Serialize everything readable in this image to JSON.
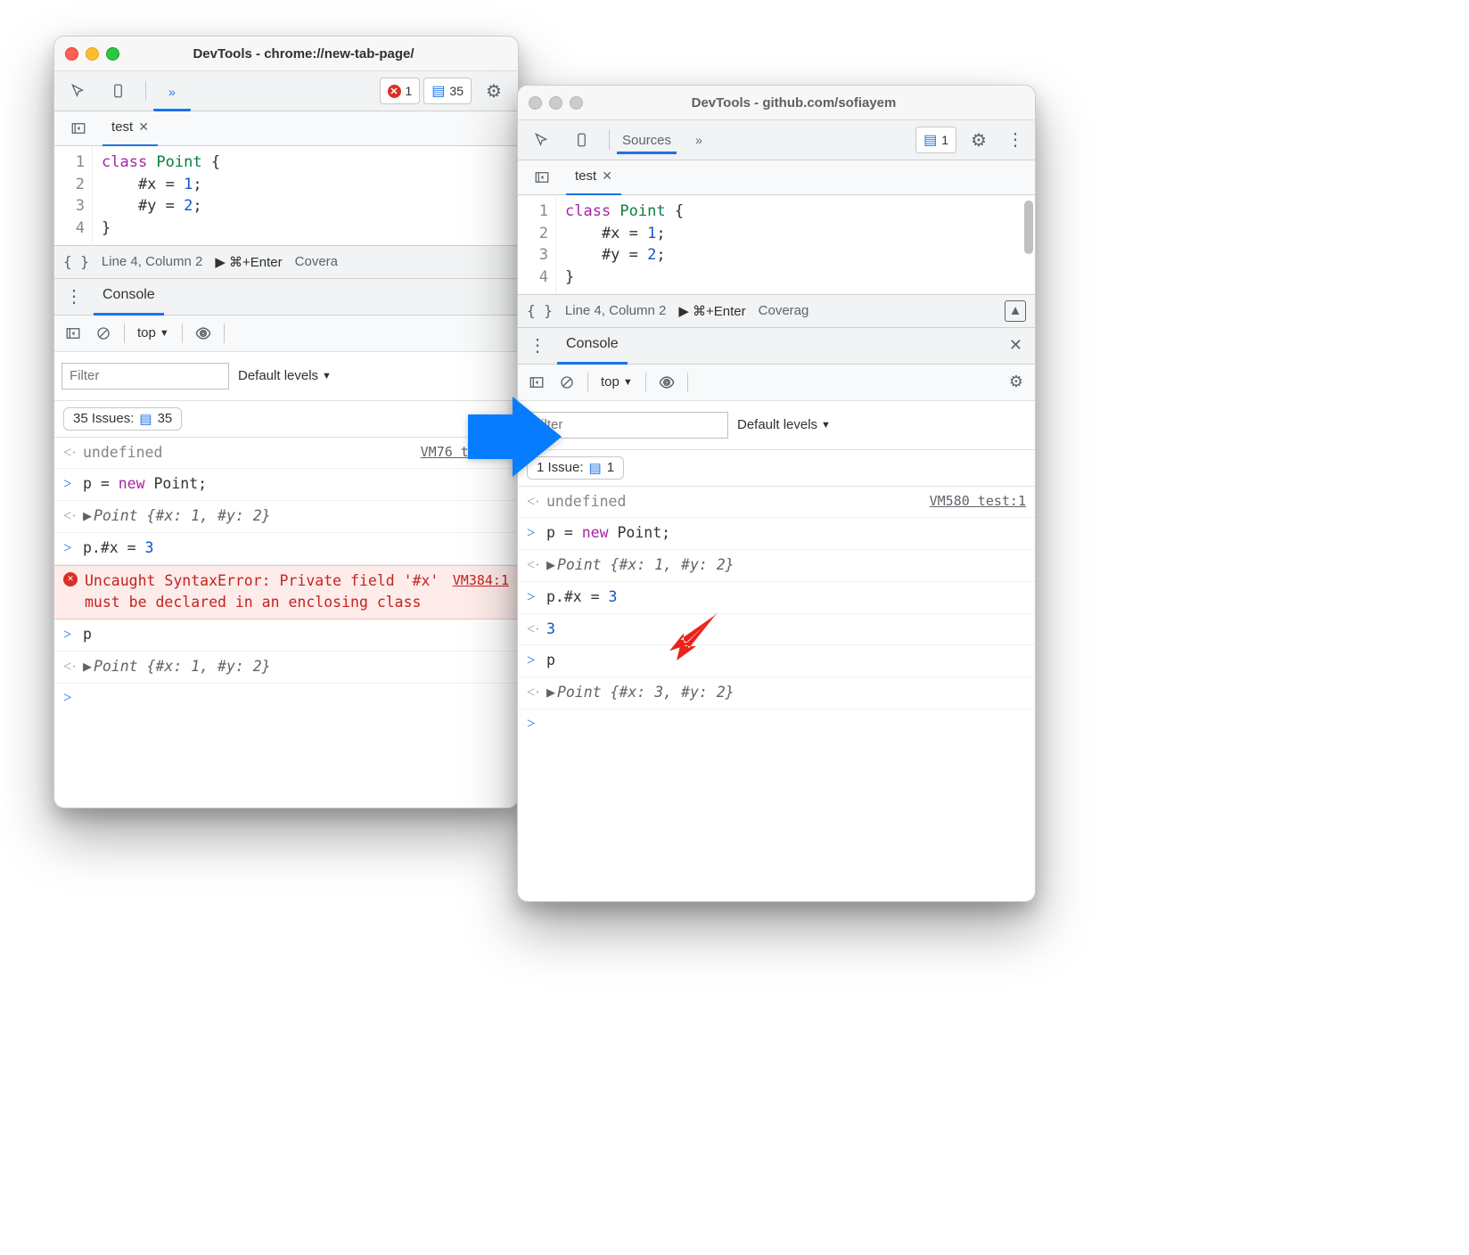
{
  "left": {
    "title_prefix": "DevTools - ",
    "title_url": "chrome://new-tab-page/",
    "errors_count": "1",
    "issues_count": "35",
    "file_tab": "test",
    "code_lines": [
      "1",
      "2",
      "3",
      "4"
    ],
    "status_line": "Line 4, Column 2",
    "status_run": "⌘+Enter",
    "status_coverage": "Covera",
    "console_tab": "Console",
    "context": "top",
    "filter_placeholder": "Filter",
    "levels_label": "Default levels",
    "issues_bar_label": "35 Issues:",
    "issues_bar_count": "35",
    "log": {
      "r0_text": "undefined",
      "r0_src": "VM76 test:1",
      "r1_code_a": "p = ",
      "r1_code_b": "new",
      "r1_code_c": " Point;",
      "r2_obj": "Point {#x: 1, #y: 2}",
      "r3_code_a": "p.#x = ",
      "r3_code_b": "3",
      "err_text": "Uncaught SyntaxError: Private field '#x' must be declared in an enclosing class",
      "err_src": "VM384:1",
      "r5_code": "p",
      "r6_obj": "Point {#x: 1, #y: 2}"
    }
  },
  "right": {
    "title_prefix": "DevTools - ",
    "title_url": "github.com/sofiayem",
    "sources_tab": "Sources",
    "issues_count": "1",
    "file_tab": "test",
    "code_lines": [
      "1",
      "2",
      "3",
      "4"
    ],
    "status_line": "Line 4, Column 2",
    "status_run": "⌘+Enter",
    "status_coverage": "Coverag",
    "console_tab": "Console",
    "context": "top",
    "filter_placeholder": "Filter",
    "levels_label": "Default levels",
    "issues_bar_label": "1 Issue:",
    "issues_bar_count": "1",
    "log": {
      "r0_text": "undefined",
      "r0_src": "VM580 test:1",
      "r1_code_a": "p = ",
      "r1_code_b": "new",
      "r1_code_c": " Point;",
      "r2_obj": "Point {#x: 1, #y: 2}",
      "r3_code_a": "p.#x = ",
      "r3_code_b": "3",
      "r4_val": "3",
      "r5_code": "p",
      "r6_obj": "Point {#x: 3, #y: 2}"
    }
  },
  "code": {
    "l1a": "class",
    "l1b": " Point",
    "l1c": " {",
    "l2": "    #x = ",
    "l2n": "1",
    "l2e": ";",
    "l3": "    #y = ",
    "l3n": "2",
    "l3e": ";",
    "l4": "}"
  }
}
